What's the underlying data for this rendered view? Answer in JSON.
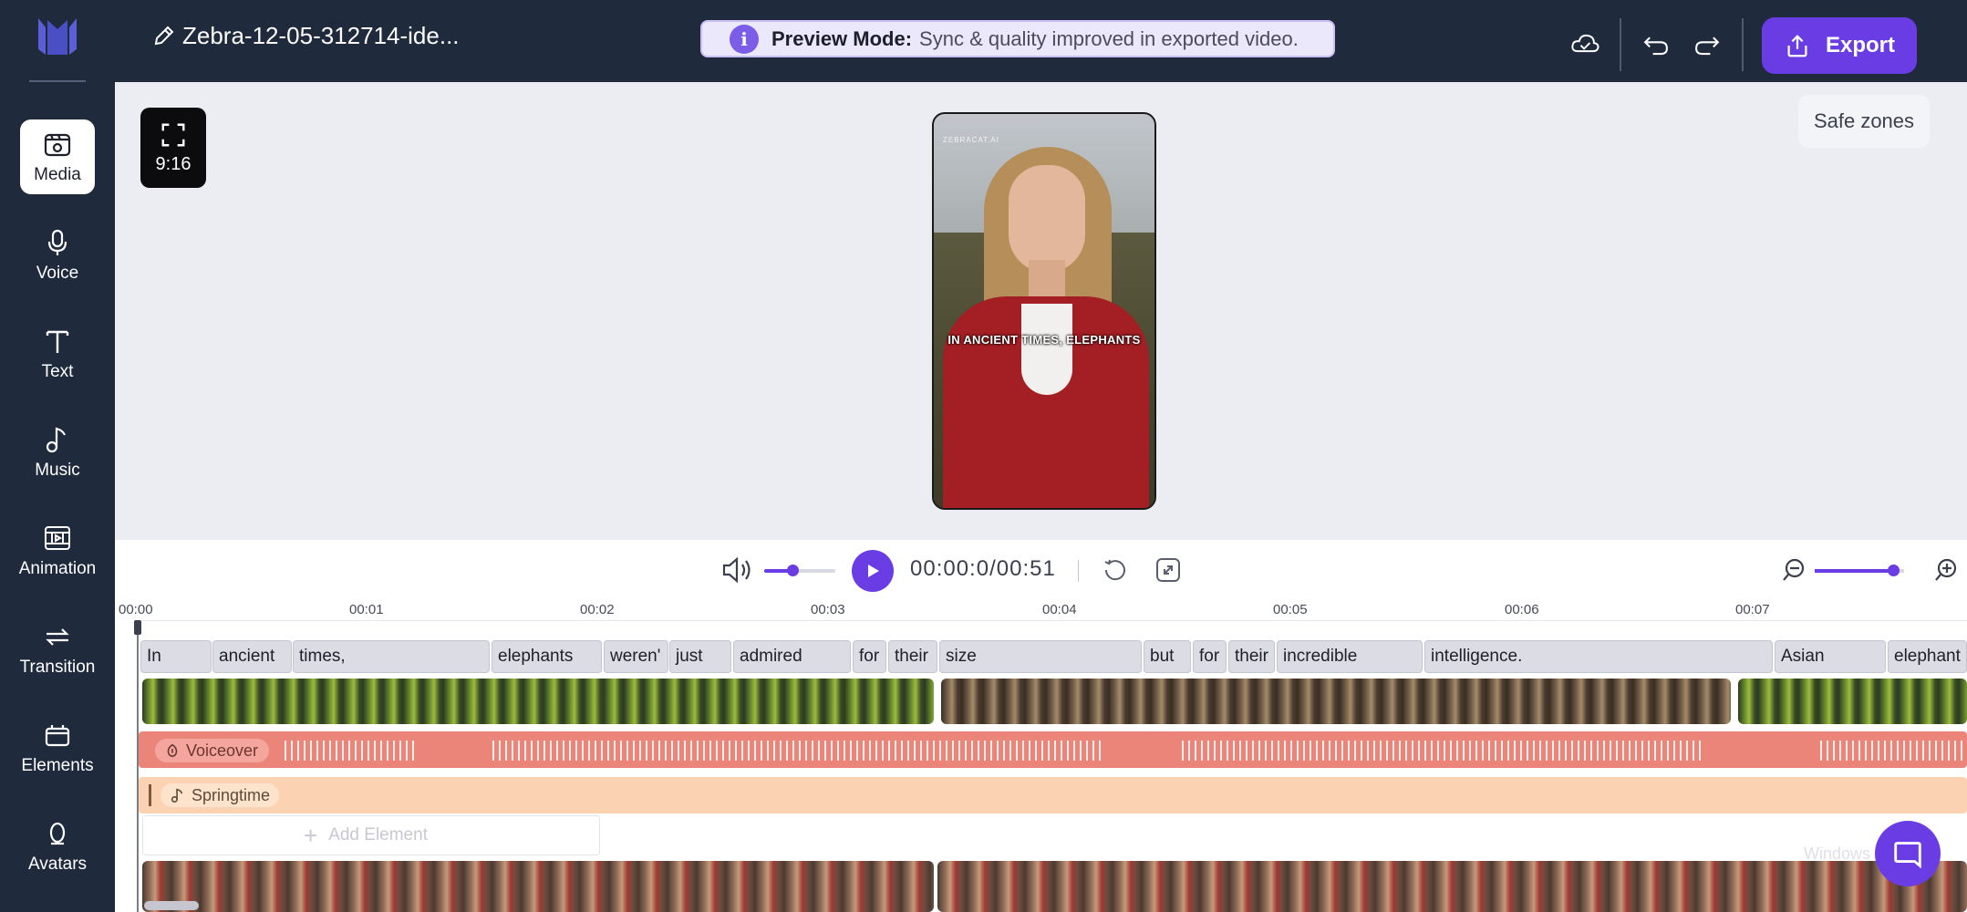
{
  "topbar": {
    "project_name": "Zebra-12-05-312714-ide...",
    "preview_title": "Preview Mode:",
    "preview_text": "Sync & quality improved in exported video.",
    "export_label": "Export"
  },
  "sidebar": {
    "items": [
      {
        "label": "Media",
        "icon": "media-icon"
      },
      {
        "label": "Voice",
        "icon": "microphone-icon"
      },
      {
        "label": "Text",
        "icon": "text-icon"
      },
      {
        "label": "Music",
        "icon": "music-note-icon"
      },
      {
        "label": "Animation",
        "icon": "animation-icon"
      },
      {
        "label": "Transition",
        "icon": "transition-icon"
      },
      {
        "label": "Elements",
        "icon": "elements-icon"
      },
      {
        "label": "Avatars",
        "icon": "avatar-icon"
      }
    ]
  },
  "canvas": {
    "aspect_ratio": "9:16",
    "safe_zones_label": "Safe zones",
    "video_caption": "IN ANCIENT TIMES, ELEPHANTS",
    "video_watermark": "ZEBRACAT.AI"
  },
  "player": {
    "timecode": "00:00:0/00:51",
    "volume_level": 0.4,
    "zoom_level": 0.88
  },
  "timeline": {
    "ruler": [
      "00:00",
      "00:01",
      "00:02",
      "00:03",
      "00:04",
      "00:05",
      "00:06",
      "00:07"
    ],
    "words": [
      "In",
      "ancient",
      "times,",
      "elephants",
      "weren'",
      "just",
      "admired",
      "for",
      "their",
      "size",
      "but",
      "for",
      "their",
      "incredible",
      "intelligence.",
      "Asian",
      "elephant"
    ],
    "voiceover_label": "Voiceover",
    "music_label": "Springtime",
    "add_element_label": "Add Element",
    "watermark": "Windows"
  },
  "colors": {
    "accent": "#6a3ce4",
    "topbar_bg": "#1f2a3c",
    "voiceover": "#ec8579",
    "music": "#fbd3b2"
  }
}
